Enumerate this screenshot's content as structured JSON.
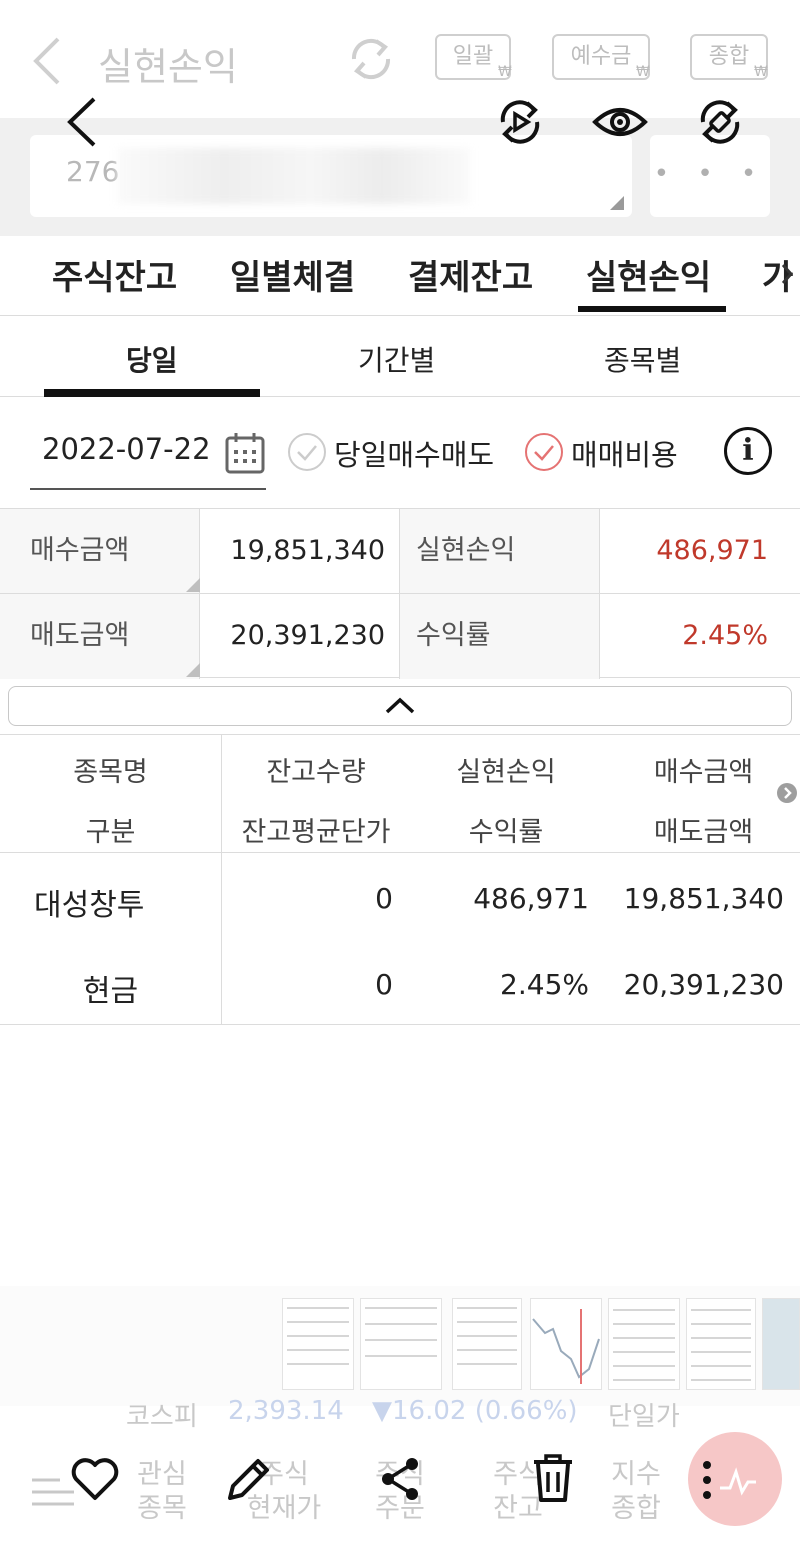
{
  "ghost_header": {
    "title": "실현손익",
    "buttons": [
      "일괄",
      "예수금",
      "종합"
    ],
    "button_subs": [
      "₩",
      "₩",
      "₩"
    ]
  },
  "account": {
    "number_prefix": "276",
    "password_mask": "• • • •"
  },
  "main_tabs": [
    "주식잔고",
    "일별체결",
    "결제잔고",
    "실현손익",
    "가"
  ],
  "main_tab_active": "실현손익",
  "sub_tabs": [
    "당일",
    "기간별",
    "종목별"
  ],
  "sub_tab_active": "당일",
  "filter": {
    "date": "2022-07-22",
    "check1": "당일매수매도",
    "check2": "매매비용",
    "info": "i"
  },
  "summary": {
    "buy_amount_label": "매수금액",
    "buy_amount": "19,851,340",
    "realized_label": "실현손익",
    "realized": "486,971",
    "sell_amount_label": "매도금액",
    "sell_amount": "20,391,230",
    "return_label": "수익률",
    "return_rate": "2.45%"
  },
  "table": {
    "headers_row1": [
      "종목명",
      "잔고수량",
      "실현손익",
      "매수금액"
    ],
    "headers_row2": [
      "구분",
      "잔고평균단가",
      "수익률",
      "매도금액"
    ],
    "rows": [
      {
        "name": "대성창투",
        "qty": "0",
        "pnl": "486,971",
        "buy": "19,851,340"
      },
      {
        "name": "현금",
        "qty": "0",
        "pnl": "2.45%",
        "buy": "20,391,230"
      }
    ]
  },
  "ticker": {
    "index_name": "코스피",
    "value": "2,393.14",
    "change": "▼16.02 (0.66%)",
    "extra": "단일가"
  },
  "bottom_nav": [
    {
      "line1": "관심",
      "line2": "종목"
    },
    {
      "line1": "주식",
      "line2": "현재가"
    },
    {
      "line1": "주식",
      "line2": "주문"
    },
    {
      "line1": "주식",
      "line2": "잔고"
    },
    {
      "line1": "지수",
      "line2": "종합"
    }
  ],
  "colors": {
    "positive": "#c0392b",
    "accent_check": "#e57373",
    "indicator": "#111111"
  }
}
